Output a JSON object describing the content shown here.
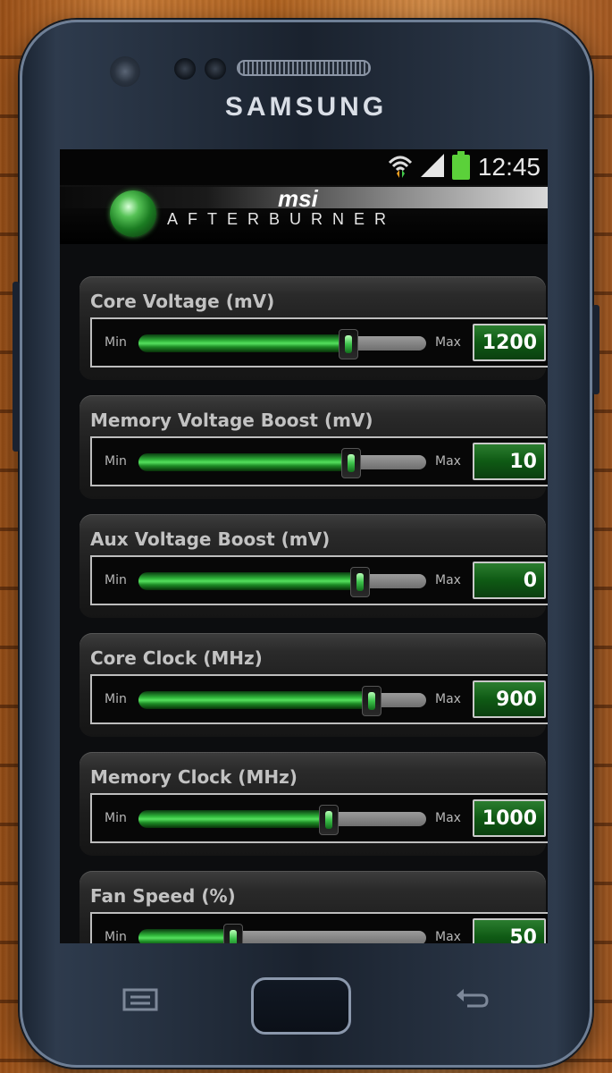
{
  "device": {
    "brand": "SAMSUNG"
  },
  "status_bar": {
    "time": "12:45",
    "icons": [
      "wifi-icon",
      "signal-icon",
      "battery-icon"
    ]
  },
  "app": {
    "logo_text_top": "msi",
    "logo_text_bottom": "AFTERBURNER"
  },
  "sliders": [
    {
      "label": "Core Voltage (mV)",
      "min_label": "Min",
      "max_label": "Max",
      "value": "1200",
      "position": 0.73
    },
    {
      "label": "Memory Voltage Boost (mV)",
      "min_label": "Min",
      "max_label": "Max",
      "value": "10",
      "position": 0.74
    },
    {
      "label": "Aux Voltage Boost (mV)",
      "min_label": "Min",
      "max_label": "Max",
      "value": "0",
      "position": 0.77
    },
    {
      "label": "Core Clock (MHz)",
      "min_label": "Min",
      "max_label": "Max",
      "value": "900",
      "position": 0.81
    },
    {
      "label": "Memory Clock (MHz)",
      "min_label": "Min",
      "max_label": "Max",
      "value": "1000",
      "position": 0.66
    },
    {
      "label": "Fan Speed (%)",
      "min_label": "Min",
      "max_label": "Max",
      "value": "50",
      "position": 0.33
    }
  ],
  "nav": {
    "menu_icon": "menu-icon",
    "home_icon": "home-button",
    "back_icon": "back-icon"
  },
  "colors": {
    "accent_green": "#2fb43a",
    "value_box": "#0f5a14"
  }
}
